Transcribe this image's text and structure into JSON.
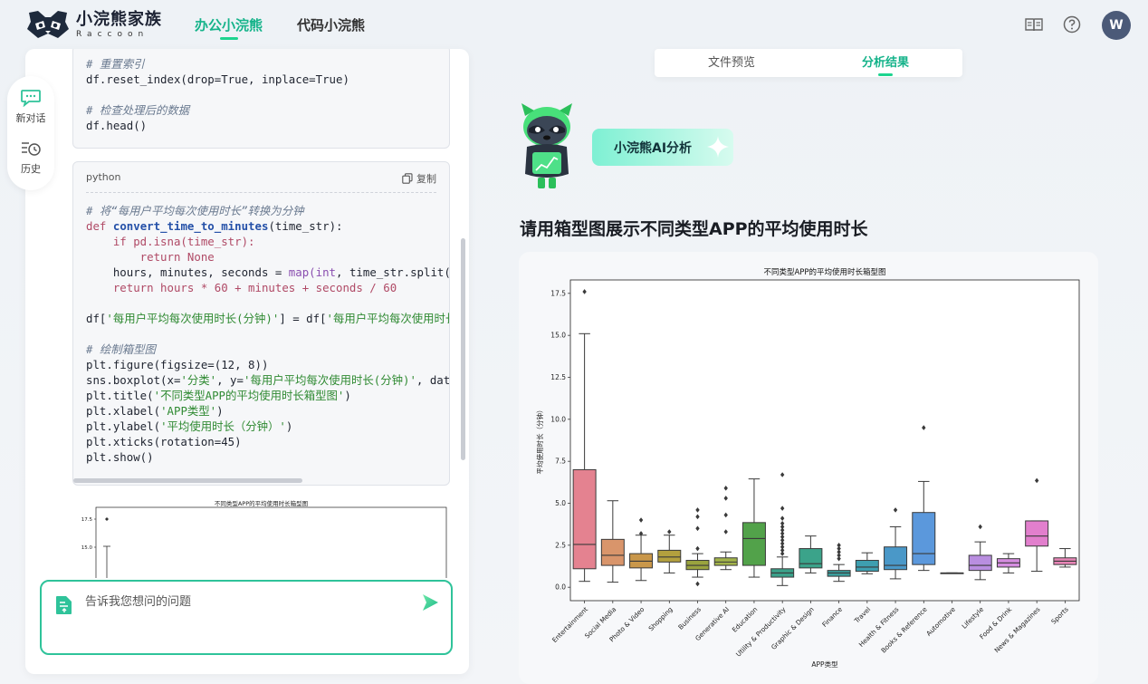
{
  "header": {
    "brand_zh": "小浣熊家族",
    "brand_en": "Raccoon",
    "tabs": [
      {
        "label": "办公小浣熊",
        "active": true
      },
      {
        "label": "代码小浣熊",
        "active": false
      }
    ],
    "avatar_letter": "W"
  },
  "rail": {
    "items": [
      {
        "label": "新对话",
        "icon": "chat-plus-icon"
      },
      {
        "label": "历史",
        "icon": "history-icon"
      }
    ]
  },
  "code_block_1": {
    "lines": [
      "# 重置索引",
      "df.reset_index(drop=True, inplace=True)",
      "",
      "# 检查处理后的数据",
      "df.head()"
    ]
  },
  "code_block_2": {
    "language": "python",
    "copy_label": "复制",
    "comment1": "# 将“每用户平均每次使用时长”转换为分钟",
    "def_kw": "def",
    "fn_name": "convert_time_to_minutes",
    "param": "(time_str):",
    "if_line": "    if pd.isna(time_str):",
    "return_none": "        return None",
    "hours_line_a": "    hours, minutes, seconds = ",
    "hours_line_b": "map(",
    "hours_line_c": "int",
    "hours_line_d": ", time_str.split(",
    "return_line": "    return hours * 60 + minutes + seconds / 60",
    "assign_a": "df[",
    "assign_s1": "'每用户平均每次使用时长(分钟)'",
    "assign_b": "] = df[",
    "assign_s2": "'每用户平均每次使用时长",
    "comment2": "# 绘制箱型图",
    "fig_line": "plt.figure(figsize=(12, 8))",
    "box_a": "sns.boxplot(x=",
    "box_s1": "'分类'",
    "box_b": ", y=",
    "box_s2": "'每用户平均每次使用时长(分钟)'",
    "box_c": ", dat",
    "title_a": "plt.title(",
    "title_s": "'不同类型APP的平均使用时长箱型图'",
    "xlabel_a": "plt.xlabel(",
    "xlabel_s": "'APP类型'",
    "ylabel_a": "plt.ylabel(",
    "ylabel_s": "'平均使用时长（分钟）'",
    "xticks_line": "plt.xticks(rotation=45)",
    "show_line": "plt.show()"
  },
  "mini_chart": {
    "title": "不同类型APP的平均使用时长箱型图",
    "tick_top": "17.5",
    "tick_2": "15.0"
  },
  "input": {
    "placeholder": "告诉我您想问的问题"
  },
  "result_tabs": [
    {
      "label": "文件预览",
      "active": false
    },
    {
      "label": "分析结果",
      "active": true
    }
  ],
  "ai_badge": "小浣熊AI分析",
  "question": "请用箱型图展示不同类型APP的平均使用时长",
  "chart_data": {
    "type": "box",
    "title": "不同类型APP的平均使用时长箱型图",
    "xlabel": "APP类型",
    "ylabel": "平均使用时长（分钟）",
    "ylim": [
      -0.8,
      18.3
    ],
    "yticks": [
      0.0,
      2.5,
      5.0,
      7.5,
      10.0,
      12.5,
      15.0,
      17.5
    ],
    "categories": [
      "Entertainment",
      "Social Media",
      "Photo & Video",
      "Shopping",
      "Business",
      "Generative AI",
      "Education",
      "Utility & Productivity",
      "Graphic & Design",
      "Finance",
      "Travel",
      "Health & Fitness",
      "Books & Reference",
      "Automotive",
      "Lifestyle",
      "Food & Drink",
      "News & Magazines",
      "Sports"
    ],
    "colors": [
      "#e48290",
      "#d9956b",
      "#c9974a",
      "#b3a03e",
      "#9aa33f",
      "#a2b34a",
      "#52a24a",
      "#3aa089",
      "#3ba38a",
      "#3b9e9c",
      "#3e9fb0",
      "#4a98c8",
      "#5b98dc",
      "#9b8fe0",
      "#b98ee0",
      "#d58de0",
      "#e27fcd",
      "#e685b5"
    ],
    "boxes": [
      {
        "whislo": 0.35,
        "q1": 1.1,
        "med": 2.55,
        "q3": 7.0,
        "whishi": 15.1,
        "fliers": [
          17.6
        ]
      },
      {
        "whislo": 0.3,
        "q1": 1.3,
        "med": 1.9,
        "q3": 2.85,
        "whishi": 5.15,
        "fliers": []
      },
      {
        "whislo": 0.4,
        "q1": 1.15,
        "med": 1.55,
        "q3": 2.0,
        "whishi": 3.1,
        "fliers": [
          4.0,
          3.2
        ]
      },
      {
        "whislo": 0.85,
        "q1": 1.5,
        "med": 1.8,
        "q3": 2.2,
        "whishi": 3.1,
        "fliers": [
          3.3
        ]
      },
      {
        "whislo": 0.6,
        "q1": 1.05,
        "med": 1.3,
        "q3": 1.6,
        "whishi": 2.0,
        "fliers": [
          4.6,
          4.2,
          3.5,
          2.3,
          0.2
        ]
      },
      {
        "whislo": 1.05,
        "q1": 1.3,
        "med": 1.5,
        "q3": 1.75,
        "whishi": 2.1,
        "fliers": [
          5.9,
          5.3,
          4.3,
          3.3
        ]
      },
      {
        "whislo": 0.6,
        "q1": 1.3,
        "med": 2.9,
        "q3": 3.85,
        "whishi": 6.45,
        "fliers": []
      },
      {
        "whislo": 0.1,
        "q1": 0.6,
        "med": 0.85,
        "q3": 1.1,
        "whishi": 1.8,
        "fliers": [
          6.7,
          4.7,
          4.1,
          3.8,
          3.6,
          3.4,
          3.2,
          3.0,
          2.8,
          2.6,
          2.4,
          2.2,
          2.0
        ]
      },
      {
        "whislo": 0.85,
        "q1": 1.15,
        "med": 1.4,
        "q3": 2.3,
        "whishi": 3.05,
        "fliers": []
      },
      {
        "whislo": 0.35,
        "q1": 0.65,
        "med": 0.85,
        "q3": 1.0,
        "whishi": 1.35,
        "fliers": [
          2.5,
          2.3,
          2.1,
          1.9,
          1.7
        ]
      },
      {
        "whislo": 0.8,
        "q1": 0.95,
        "med": 1.2,
        "q3": 1.6,
        "whishi": 2.05,
        "fliers": []
      },
      {
        "whislo": 0.5,
        "q1": 1.05,
        "med": 1.3,
        "q3": 2.4,
        "whishi": 3.6,
        "fliers": [
          4.6
        ]
      },
      {
        "whislo": 1.0,
        "q1": 1.35,
        "med": 2.0,
        "q3": 4.45,
        "whishi": 6.3,
        "fliers": [
          9.5
        ]
      },
      {
        "whislo": 0.85,
        "q1": 0.85,
        "med": 0.85,
        "q3": 0.85,
        "whishi": 0.85,
        "fliers": []
      },
      {
        "whislo": 0.45,
        "q1": 1.0,
        "med": 1.3,
        "q3": 1.9,
        "whishi": 2.7,
        "fliers": [
          3.6
        ]
      },
      {
        "whislo": 0.85,
        "q1": 1.2,
        "med": 1.45,
        "q3": 1.7,
        "whishi": 2.0,
        "fliers": []
      },
      {
        "whislo": 0.95,
        "q1": 2.45,
        "med": 3.05,
        "q3": 3.95,
        "whishi": 3.95,
        "fliers": [
          6.35
        ]
      },
      {
        "whislo": 1.2,
        "q1": 1.35,
        "med": 1.55,
        "q3": 1.75,
        "whishi": 2.3,
        "fliers": []
      }
    ]
  }
}
